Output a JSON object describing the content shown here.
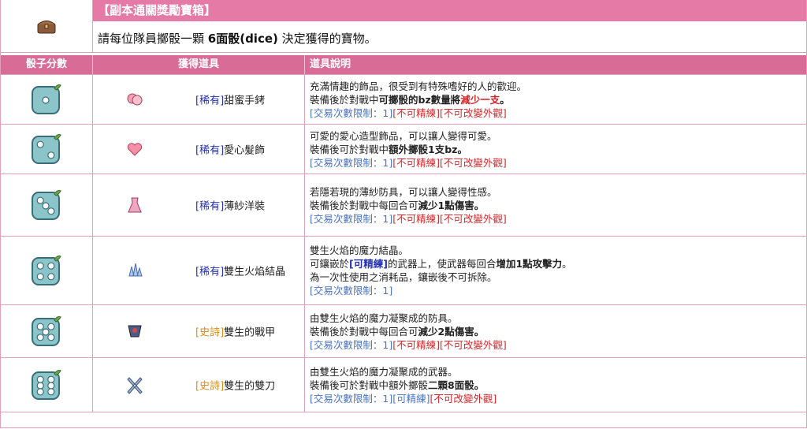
{
  "header": {
    "title": "【副本通關獎勵寶箱】",
    "desc_prefix": "請每位隊員擲骰一顆 ",
    "desc_bold": "6面骰(dice)",
    "desc_suffix": " 決定獲得的寶物。"
  },
  "table": {
    "col_dice": "骰子分數",
    "col_item": "獲得道具",
    "col_desc": "道具說明"
  },
  "rows": [
    {
      "dice": 1,
      "item_icon": "bracelet-icon",
      "tag": "[稀有]",
      "name": "甜蜜手銬",
      "line1": "充滿情趣的飾品，很受到有特殊嗜好的人的歡迎。",
      "line2a": "裝備後於對戰中",
      "line2b": "可擲骰的bz數量將",
      "line2c": "減少一支",
      "line2d": "。",
      "trade": "[交易次數限制：1]",
      "t2": "[不可精練]",
      "t3": "[不可改變外觀]"
    },
    {
      "dice": 2,
      "item_icon": "heart-icon",
      "tag": "[稀有]",
      "name": "愛心髮飾",
      "line1": "可愛的愛心造型飾品，可以讓人變得可愛。",
      "line2a": "裝備後可於對戰中",
      "line2b": "額外擲骰1支bz",
      "line2c": "",
      "line2d": "。",
      "trade": "[交易次數限制：1]",
      "t2": "[不可精練]",
      "t3": "[不可改變外觀]"
    },
    {
      "dice": 3,
      "item_icon": "dress-icon",
      "tag": "[稀有]",
      "name": "薄紗洋裝",
      "line1": "若隱若現的薄紗防具，可以讓人變得性感。",
      "line2a": "裝備後於對戰中每回合可",
      "line2b": "減少1點傷害",
      "line2c": "",
      "line2d": "。",
      "trade": "[交易次數限制：1]",
      "t2": "[不可精練]",
      "t3": "[不可改變外觀]"
    },
    {
      "dice": 4,
      "item_icon": "crystal-icon",
      "tag": "[稀有]",
      "name": "雙生火焰結晶",
      "line1": "雙生火焰的魔力結晶。",
      "l2_pre": "可鑲嵌於",
      "l2_blue": "[可精練]",
      "l2_mid": "的武器上，使武器每回合",
      "l2_bold": "增加1點攻擊力",
      "l2_end": "。",
      "line3": "為一次性使用之消耗品，鑲嵌後不可拆除。",
      "trade": "[交易次數限制：1]"
    },
    {
      "dice": 5,
      "item_icon": "armor-icon",
      "tag": "[史詩]",
      "name": "雙生的戰甲",
      "line1": "由雙生火焰的魔力凝聚成的防具。",
      "line2a": "裝備後於對戰中每回合可",
      "line2b": "減少2點傷害",
      "line2c": "",
      "line2d": "。",
      "trade": "[交易次數限制：1]",
      "t2": "[不可精練]",
      "t3": "[不可改變外觀]"
    },
    {
      "dice": 6,
      "item_icon": "twin-blades-icon",
      "tag": "[史詩]",
      "name": "雙生的雙刀",
      "line1": "由雙生火焰的魔力凝聚成的武器。",
      "line2a": "裝備後可於對戰中額外擲骰",
      "line2b": "二顆8面骰",
      "line2c": "",
      "line2d": "。",
      "trade": "[交易次數限制：1]",
      "t2": "[可精練]",
      "t3": "[不可改變外觀]"
    }
  ],
  "colors": {
    "header_pink": "#e57aa7",
    "table_header": "#d96b97",
    "dice_fill": "#8cc5c9",
    "dice_border": "#3a6d7a"
  }
}
